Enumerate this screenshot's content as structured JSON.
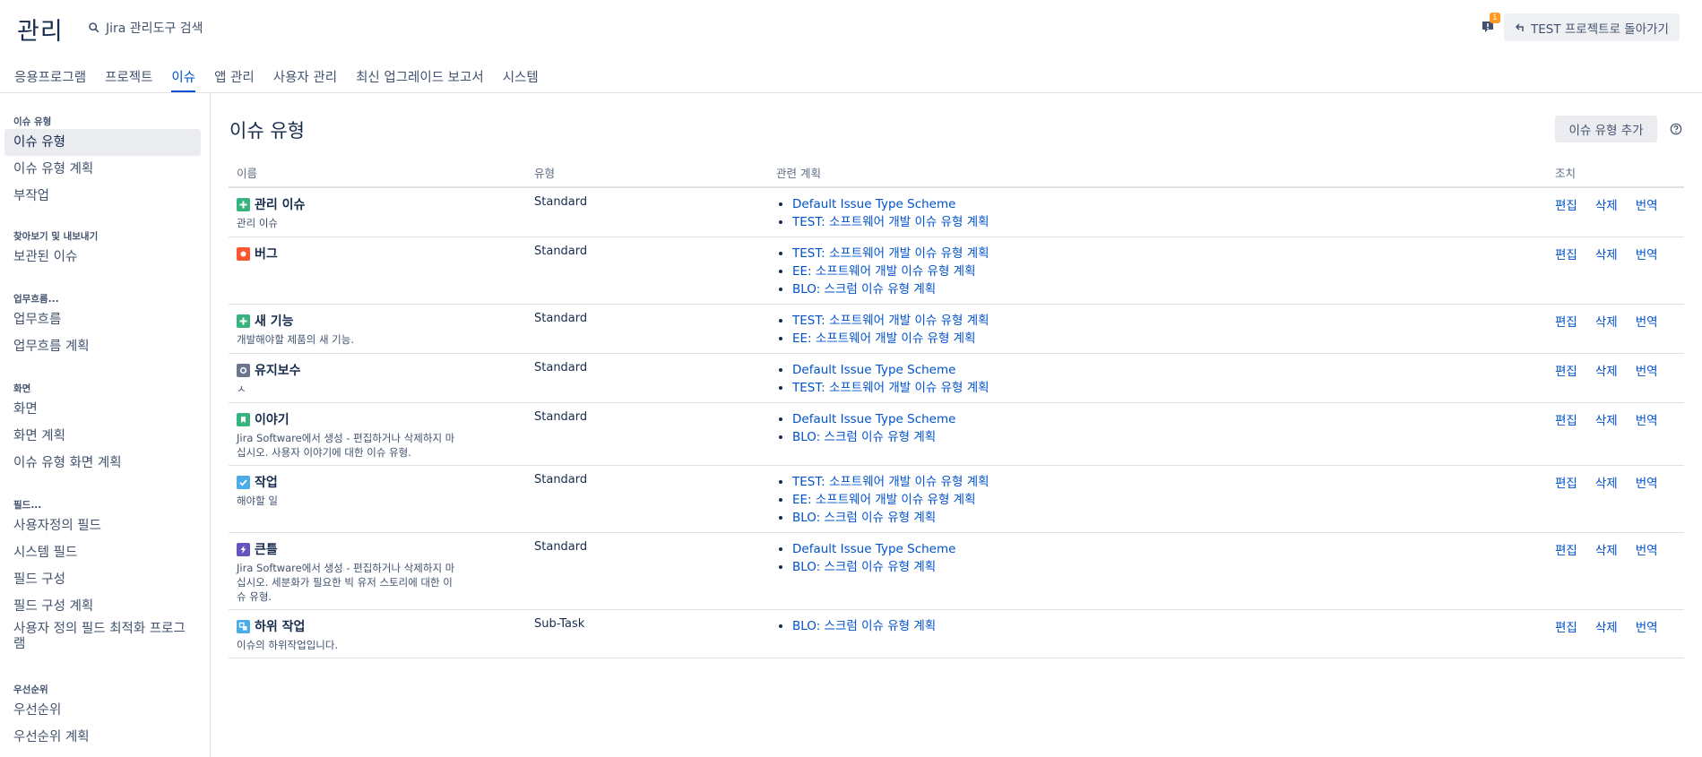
{
  "header": {
    "title": "관리",
    "search_label": "Jira 관리도구 검색",
    "notif_count": "1",
    "back_button": "TEST 프로젝트로 돌아가기"
  },
  "tabs": [
    "응용프로그램",
    "프로젝트",
    "이슈",
    "앱 관리",
    "사용자 관리",
    "최신 업그레이드 보고서",
    "시스템"
  ],
  "sidebar": {
    "groups": [
      "이슈 유형",
      "찾아보기 및 내보내기",
      "업무흐름...",
      "화면",
      "필드...",
      "우선순위"
    ],
    "items": [
      "이슈 유형",
      "이슈 유형 계획",
      "부작업",
      "보관된 이슈",
      "업무흐름",
      "업무흐름 계획",
      "화면",
      "화면 계획",
      "이슈 유형 화면 계획",
      "사용자정의 필드",
      "시스템 필드",
      "필드 구성",
      "필드 구성 계획",
      "사용자 정의 필드 최적화 프로그램",
      "우선순위",
      "우선순위 계획"
    ]
  },
  "main": {
    "title": "이슈 유형",
    "add_button": "이슈 유형 추가",
    "columns": [
      "이름",
      "유형",
      "관련 계획",
      "조치"
    ],
    "action_labels": [
      "편집",
      "삭제",
      "번역"
    ],
    "rows": [
      {
        "name": "관리 이슈",
        "desc": "관리 이슈",
        "type": "Standard",
        "schemes": [
          "Default Issue Type Scheme",
          "TEST: 소프트웨어 개발 이슈 유형 계획"
        ],
        "icon": "plus-icon",
        "color": "#36b37e"
      },
      {
        "name": "버그",
        "desc": "",
        "type": "Standard",
        "schemes": [
          "TEST: 소프트웨어 개발 이슈 유형 계획",
          "EE: 소프트웨어 개발 이슈 유형 계획",
          "BLO: 스크럼 이슈 유형 계획"
        ],
        "icon": "bug-icon",
        "color": "#ff5630"
      },
      {
        "name": "새 기능",
        "desc": "개발해야할 제품의 새 기능.",
        "type": "Standard",
        "schemes": [
          "TEST: 소프트웨어 개발 이슈 유형 계획",
          "EE: 소프트웨어 개발 이슈 유형 계획"
        ],
        "icon": "plus-icon",
        "color": "#36b37e"
      },
      {
        "name": "유지보수",
        "desc": "ㅅ",
        "type": "Standard",
        "schemes": [
          "Default Issue Type Scheme",
          "TEST: 소프트웨어 개발 이슈 유형 계획"
        ],
        "icon": "circle-icon",
        "color": "#6b778c"
      },
      {
        "name": "이야기",
        "desc": "Jira Software에서 생성 - 편집하거나 삭제하지 마십시오. 사용자 이야기에 대한 이슈 유형.",
        "type": "Standard",
        "schemes": [
          "Default Issue Type Scheme",
          "BLO: 스크럼 이슈 유형 계획"
        ],
        "icon": "bookmark-icon",
        "color": "#36b37e"
      },
      {
        "name": "작업",
        "desc": "해야할 일",
        "type": "Standard",
        "schemes": [
          "TEST: 소프트웨어 개발 이슈 유형 계획",
          "EE: 소프트웨어 개발 이슈 유형 계획",
          "BLO: 스크럼 이슈 유형 계획"
        ],
        "icon": "check-icon",
        "color": "#4bade8"
      },
      {
        "name": "큰틀",
        "desc": "Jira Software에서 생성 - 편집하거나 삭제하지 마십시오. 세분화가 필요한 빅 유저 스토리에 대한 이슈 유형.",
        "type": "Standard",
        "schemes": [
          "Default Issue Type Scheme",
          "BLO: 스크럼 이슈 유형 계획"
        ],
        "icon": "bolt-icon",
        "color": "#6554c0"
      },
      {
        "name": "하위 작업",
        "desc": "이슈의 하위작업입니다.",
        "type": "Sub-Task",
        "schemes": [
          "BLO: 스크럼 이슈 유형 계획"
        ],
        "icon": "subtask-icon",
        "color": "#4bade8"
      }
    ]
  }
}
